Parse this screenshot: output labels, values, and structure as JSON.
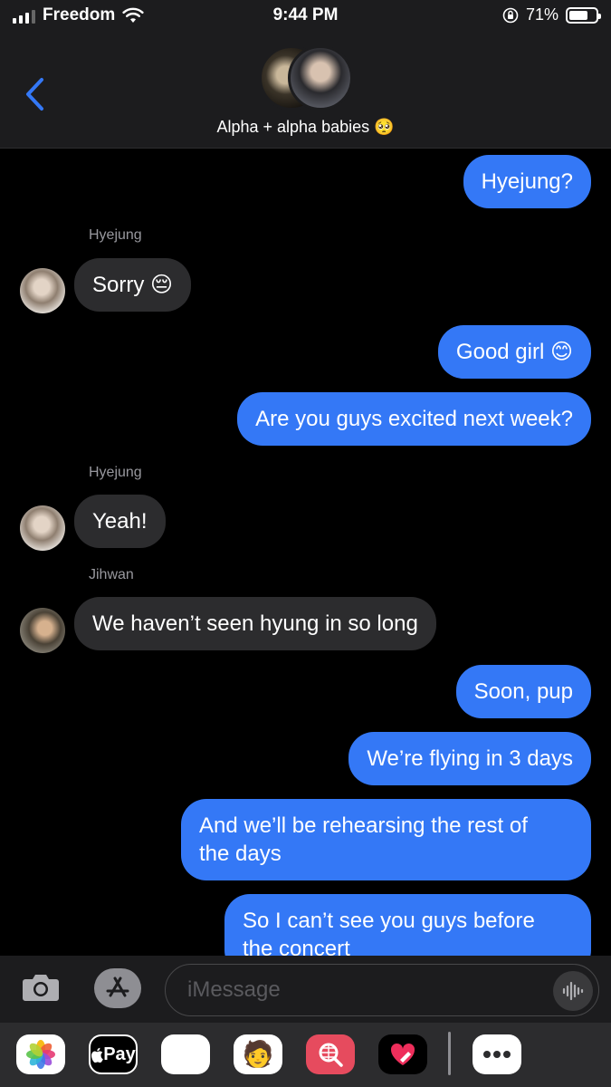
{
  "status_bar": {
    "carrier": "Freedom",
    "time": "9:44 PM",
    "battery": "71%"
  },
  "header": {
    "title": "Alpha + alpha babies 🥺"
  },
  "messages": [
    {
      "dir": "out",
      "text": "Hyejung?"
    },
    {
      "sender": "Hyejung",
      "dir": "in",
      "text": "Sorry 😔"
    },
    {
      "dir": "out",
      "text": "Good girl 😊"
    },
    {
      "dir": "out",
      "text": "Are you guys excited next week?"
    },
    {
      "sender": "Hyejung",
      "dir": "in",
      "text": "Yeah!"
    },
    {
      "sender": "Jihwan",
      "dir": "in",
      "text": "We haven’t seen hyung in so long"
    },
    {
      "dir": "out",
      "text": "Soon, pup"
    },
    {
      "dir": "out",
      "text": "We’re flying in 3 days"
    },
    {
      "dir": "out",
      "text": "And we’ll be rehearsing the rest of"
    },
    {
      "dir": "out",
      "text": "the days"
    },
    {
      "dir": "out",
      "text": "So I can’t see you guys before"
    },
    {
      "dir": "out",
      "text": "the concert"
    }
  ],
  "input": {
    "placeholder": "iMessage"
  },
  "drawer": {
    "apple_pay_label": "Pay"
  },
  "colors": {
    "blue_bubble": "#3478f6",
    "gray_bubble": "#2c2c2e",
    "accent": "#3478f6"
  }
}
